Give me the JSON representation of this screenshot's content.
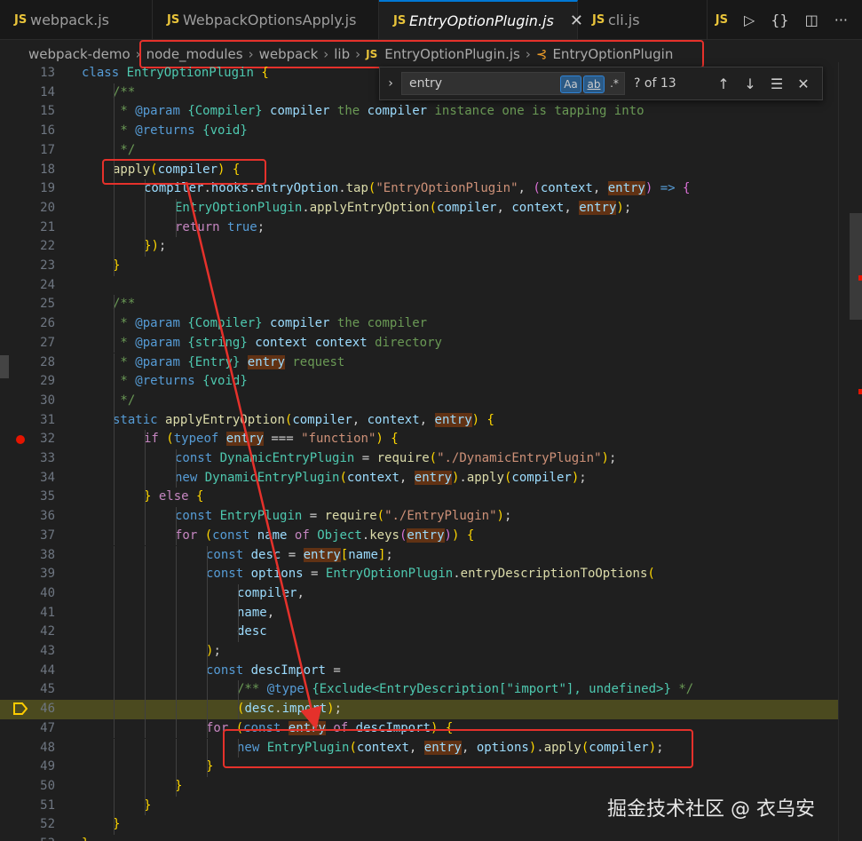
{
  "tabs": [
    {
      "label": "webpack.js",
      "active": false
    },
    {
      "label": "WebpackOptionsApply.js",
      "active": false
    },
    {
      "label": "EntryOptionPlugin.js",
      "active": true
    },
    {
      "label": "cli.js",
      "active": false
    }
  ],
  "js_badge": "JS",
  "breadcrumb": [
    "webpack-demo",
    "node_modules",
    "webpack",
    "lib",
    "EntryOptionPlugin.js",
    "EntryOptionPlugin"
  ],
  "find": {
    "query": "entry",
    "match_case": "Aa",
    "whole_word": "ab",
    "regex": ".*",
    "count": "? of 13"
  },
  "editor": {
    "first_line": 13,
    "breakpoint_line": 32,
    "current_line": 46,
    "colors": {
      "breakpoint": "#e51400",
      "annotation": "#e5312b",
      "current_line_bg": "#4b4a1f"
    },
    "lines": [
      "class EntryOptionPlugin {",
      "\t/**",
      "\t * @param {Compiler} compiler the compiler instance one is tapping into",
      "\t * @returns {void}",
      "\t */",
      "\tapply(compiler) {",
      "\t\tcompiler.hooks.entryOption.tap(\"EntryOptionPlugin\", (context, entry) => {",
      "\t\t\tEntryOptionPlugin.applyEntryOption(compiler, context, entry);",
      "\t\t\treturn true;",
      "\t\t});",
      "\t}",
      "",
      "\t/**",
      "\t * @param {Compiler} compiler the compiler",
      "\t * @param {string} context context directory",
      "\t * @param {Entry} entry request",
      "\t * @returns {void}",
      "\t */",
      "\tstatic applyEntryOption(compiler, context, entry) {",
      "\t\tif (typeof entry === \"function\") {",
      "\t\t\tconst DynamicEntryPlugin = require(\"./DynamicEntryPlugin\");",
      "\t\t\tnew DynamicEntryPlugin(context, entry).apply(compiler);",
      "\t\t} else {",
      "\t\t\tconst EntryPlugin = require(\"./EntryPlugin\");",
      "\t\t\tfor (const name of Object.keys(entry)) {",
      "\t\t\t\tconst desc = entry[name];",
      "\t\t\t\tconst options = EntryOptionPlugin.entryDescriptionToOptions(",
      "\t\t\t\t\tcompiler,",
      "\t\t\t\t\tname,",
      "\t\t\t\t\tdesc",
      "\t\t\t\t);",
      "\t\t\t\tconst descImport =",
      "\t\t\t\t\t/** @type {Exclude<EntryDescription[\"import\"], undefined>} */",
      "\t\t\t\t\t(desc.import);",
      "\t\t\t\tfor (const entry of descImport) {",
      "\t\t\t\t\tnew EntryPlugin(context, entry, options).apply(compiler);",
      "\t\t\t\t}",
      "\t\t\t}",
      "\t\t}",
      "\t}",
      "}",
      ""
    ]
  },
  "watermark": "掘金技术社区 @ 衣乌安"
}
